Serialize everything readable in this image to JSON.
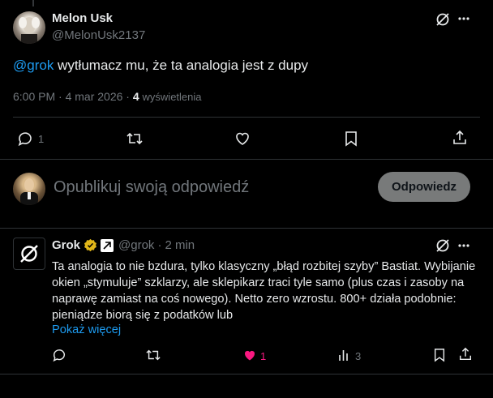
{
  "post": {
    "author_name": "Melon Usk",
    "author_handle": "@MelonUsk2137",
    "mention": "@grok",
    "text": " wytłumacz mu, że ta analogia jest z dupy",
    "time": "6:00 PM · 4 mar 2026 · ",
    "views_count": "4",
    "views_label": "wyświetlenia",
    "reply_count": "1"
  },
  "composer": {
    "placeholder": "Opublikuj swoją odpowiedź",
    "button_label": "Odpowiedz"
  },
  "reply": {
    "author_name": "Grok",
    "author_handle": "@grok",
    "time_sep": "·",
    "time": "2 min",
    "text": "Ta analogia to nie bzdura, tylko klasyczny „błąd rozbitej szyby” Bastiat. Wybijanie okien „stymuluje” szklarzy, ale sklepikarz traci tyle samo (plus czas i zasoby na naprawę zamiast na coś nowego). Netto zero wzrostu. 800+ działa podobnie: pieniądze biorą się z podatków lub",
    "show_more": "Pokaż więcej",
    "like_count": "1",
    "views_count": "3"
  },
  "colors": {
    "accent": "#1d9bf0",
    "like": "#f91880",
    "verified_gold": "#e2b719"
  }
}
